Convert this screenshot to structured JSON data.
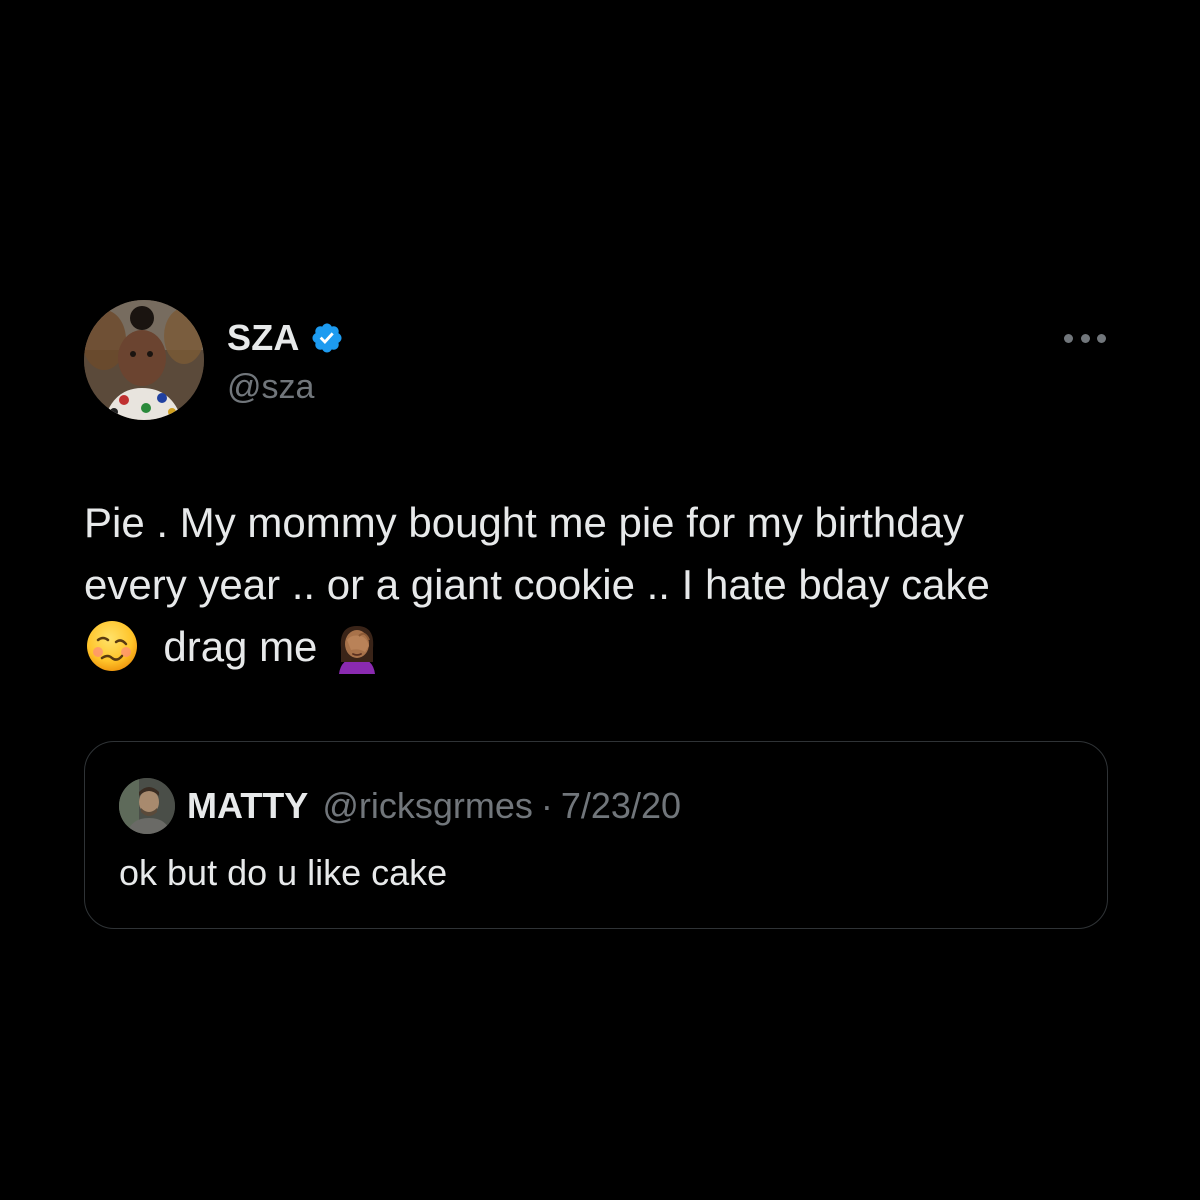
{
  "tweet": {
    "author": {
      "name": "SZA",
      "handle": "@sza",
      "verified": true,
      "avatar_icon": "profile-photo-child"
    },
    "more_icon": "more-horizontal-icon",
    "text_lines": [
      "Pie . My mommy bought me pie for my birthday",
      "every year .. or a giant cookie .. I hate bday cake",
      "drag me"
    ],
    "emojis": [
      "woozy-face-emoji",
      "woman-facepalming-emoji"
    ],
    "quoted": {
      "name": "MATTY",
      "handle": "@ricksgrmes",
      "separator": "·",
      "date": "7/23/20",
      "text": "ok but do u like cake"
    }
  },
  "colors": {
    "background": "#000000",
    "primary_text": "#e7e9ea",
    "secondary_text": "#71767b",
    "verified_blue": "#1d9bf0",
    "border": "#2f3336"
  }
}
